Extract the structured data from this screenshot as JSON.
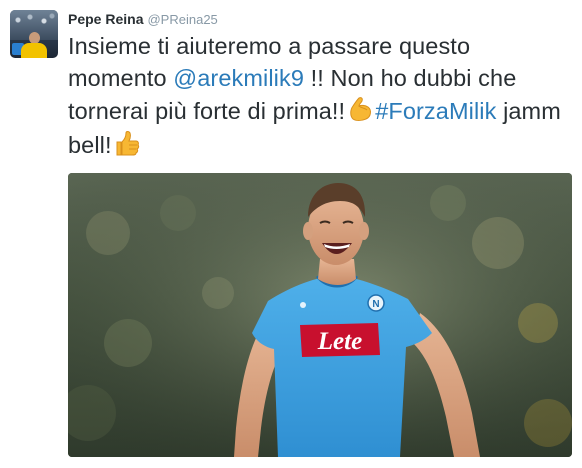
{
  "tweet": {
    "author_name": "Pepe Reina",
    "author_handle": "@PReina25",
    "text_part1": "Insieme ti aiuteremo a passare questo momento ",
    "mention": "@arekmilik9",
    "text_part2": " !! Non ho dubbi che tornerai più forte di prima!!",
    "hashtag": "#ForzaMilik",
    "text_part3": " jamm bell!",
    "emoji_1": "flexed-biceps-emoji",
    "emoji_2": "thumbs-up-emoji"
  },
  "media": {
    "jersey_sponsor": "Lete",
    "colors": {
      "jersey": "#3fa3e0",
      "sponsor_band": "#c8102e",
      "background_dark": "#3d4a35"
    }
  },
  "colors": {
    "link": "#2b7bb9",
    "text": "#292f33",
    "muted": "#8899a6"
  }
}
